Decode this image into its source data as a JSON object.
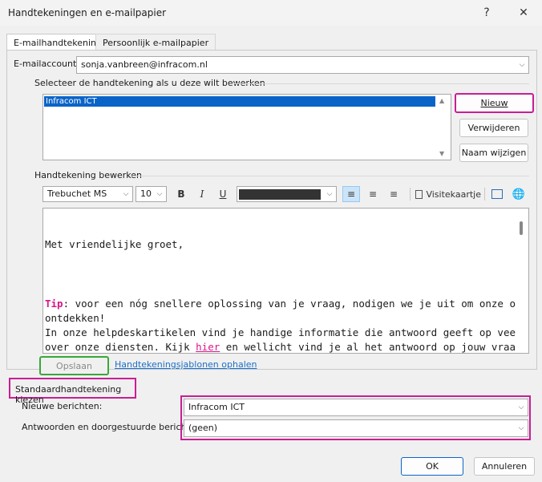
{
  "window": {
    "title": "Handtekeningen en e-mailpapier",
    "help_label": "?",
    "close_label": "✕"
  },
  "tabs": [
    {
      "label": "E-mailhandtekening",
      "active": true
    },
    {
      "label": "Persoonlijk e-mailpapier",
      "active": false
    }
  ],
  "account": {
    "label": "E-mailaccount:",
    "value": "sonja.vanbreen@infracom.nl"
  },
  "select_signature": {
    "label": "Selecteer de handtekening als u deze wilt bewerken",
    "items": [
      "Infracom ICT"
    ],
    "selected_index": 0
  },
  "buttons": {
    "new": "Nieuw",
    "delete": "Verwijderen",
    "rename": "Naam wijzigen",
    "save": "Opslaan",
    "ok": "OK",
    "cancel": "Annuleren"
  },
  "edit": {
    "label": "Handtekening bewerken",
    "font": "Trebuchet MS",
    "size": "10",
    "bold": "B",
    "italic": "I",
    "underline": "U",
    "business_card": "Visitekaartje"
  },
  "body": {
    "line1": "Met vriendelijke groet,",
    "tip_label": "Tip",
    "tip_rest": ": voor een nóg snellere oplossing van je vraag, nodigen we je uit om onze online helpdesk te",
    "line3": "ontdekken!",
    "line4": "In onze helpdeskartikelen vind je handige informatie die antwoord geeft op veelgestelde vragen",
    "line5_a": "over onze diensten. Kijk ",
    "line5_link": "hier",
    "line5_b": " en wellicht vind je al het antwoord op jouw vraag."
  },
  "templates_link": "Handtekeningsjablonen ophalen",
  "default_signature": {
    "title": "Standaardhandtekening kiezen",
    "new_messages_label": "Nieuwe berichten:",
    "new_messages_value": "Infracom ICT",
    "replies_label": "Antwoorden en doorgestuurde berichten:",
    "replies_value": "(geen)"
  },
  "colors": {
    "accent": "#c81e96",
    "selection": "#0a64c8",
    "tip": "#d6168a",
    "link": "#1a6fc8",
    "save_highlight": "#3aa83a"
  }
}
